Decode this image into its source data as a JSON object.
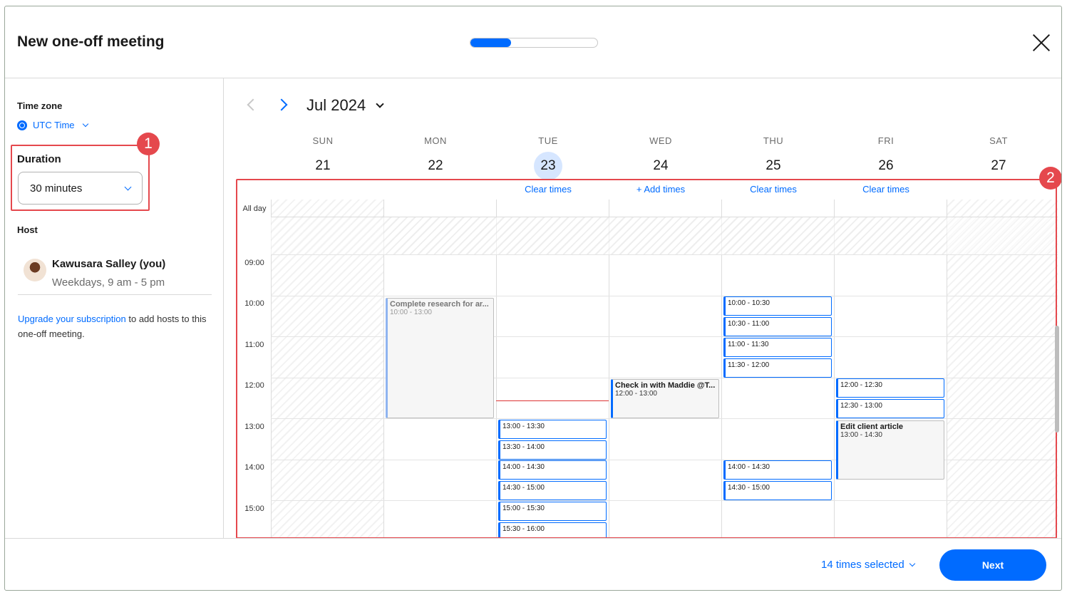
{
  "header": {
    "title": "New one-off meeting",
    "progress_fraction": 0.32
  },
  "sidebar": {
    "timezone_label": "Time zone",
    "timezone_value": "UTC Time",
    "duration_label": "Duration",
    "duration_value": "30 minutes",
    "host_label": "Host",
    "host_name": "Kawusara Salley (you)",
    "host_hours": "Weekdays, 9 am - 5 pm",
    "upgrade_link": "Upgrade your subscription",
    "upgrade_text": " to add hosts to this one-off meeting."
  },
  "annotations": {
    "badge_1": "1",
    "badge_2": "2"
  },
  "calendar": {
    "month": "Jul 2024",
    "days": [
      {
        "dow": "SUN",
        "num": "21"
      },
      {
        "dow": "MON",
        "num": "22"
      },
      {
        "dow": "TUE",
        "num": "23"
      },
      {
        "dow": "WED",
        "num": "24"
      },
      {
        "dow": "THU",
        "num": "25"
      },
      {
        "dow": "FRI",
        "num": "26"
      },
      {
        "dow": "SAT",
        "num": "27"
      }
    ],
    "today_index": 2,
    "day_actions": [
      "",
      "",
      "Clear times",
      "+ Add times",
      "Clear times",
      "Clear times",
      ""
    ],
    "allday_label": "All day",
    "hours": [
      "09:00",
      "10:00",
      "11:00",
      "12:00",
      "13:00",
      "14:00",
      "15:00"
    ],
    "slots": {
      "tue": [
        "13:00 - 13:30",
        "13:30 - 14:00",
        "14:00 - 14:30",
        "14:30 - 15:00",
        "15:00 - 15:30",
        "15:30 - 16:00"
      ],
      "thu_morning": [
        "10:00 - 10:30",
        "10:30 - 11:00",
        "11:00 - 11:30",
        "11:30 - 12:00"
      ],
      "thu_afternoon": [
        "14:00 - 14:30",
        "14:30 - 15:00"
      ],
      "fri": [
        "12:00 - 12:30",
        "12:30 - 13:00"
      ]
    },
    "events": {
      "mon": {
        "title": "Complete research for ar...",
        "time": "10:00 - 13:00"
      },
      "wed": {
        "title": "Check in with Maddie @T...",
        "time": "12:00 - 13:00"
      },
      "fri": {
        "title": "Edit client article",
        "time": "13:00 - 14:30"
      }
    }
  },
  "footer": {
    "times_selected": "14 times selected",
    "next_label": "Next"
  },
  "colors": {
    "accent": "#006bff",
    "annotation": "#e5484d",
    "today_bg": "#d6e6ff"
  }
}
